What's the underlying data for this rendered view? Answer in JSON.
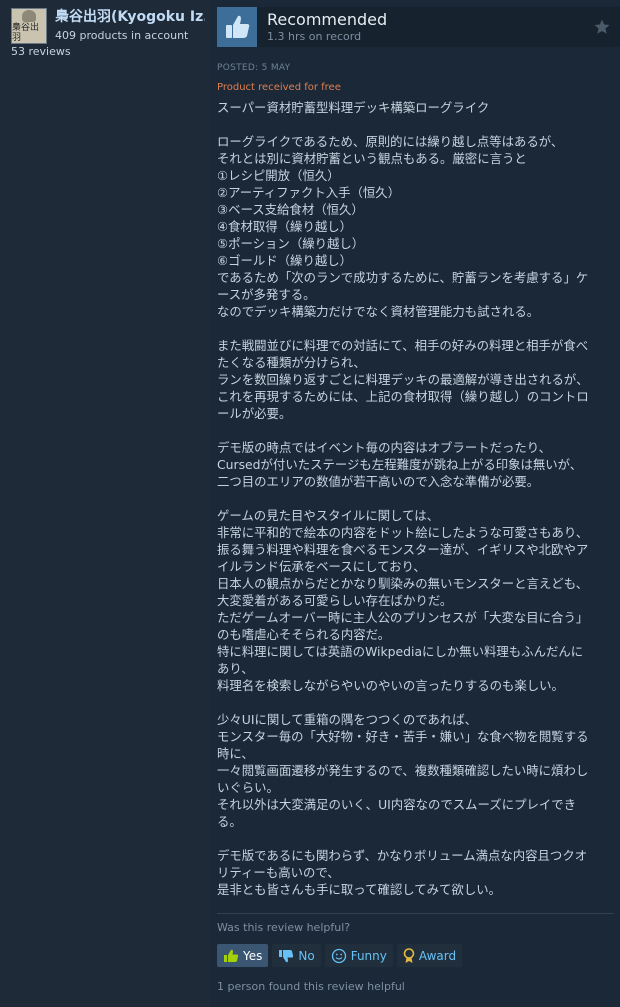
{
  "author": {
    "avatar_text": "梟谷出羽",
    "name": "梟谷出羽(Kyogoku Iz...",
    "products": "409 products in account",
    "reviews": "53 reviews"
  },
  "review": {
    "verdict": "Recommended",
    "hours": "1.3 hrs on record",
    "posted": "POSTED: 5 MAY",
    "received_free": "Product received for free",
    "lines": [
      "スーパー資材貯蓄型料理デッキ構築ローグライク",
      "",
      "ローグライクであるため、原則的には繰り越し点等はあるが、",
      "それとは別に資材貯蓄という観点もある。厳密に言うと",
      "①レシピ開放（恒久）",
      "②アーティファクト入手（恒久）",
      "③ベース支給食材（恒久）",
      "④食材取得（繰り越し）",
      "⑤ポーション（繰り越し）",
      "⑥ゴールド（繰り越し）",
      "であるため「次のランで成功するために、貯蓄ランを考慮する」ケ",
      "ースが多発する。",
      "なのでデッキ構築力だけでなく資材管理能力も試される。",
      "",
      "また戦闘並びに料理での対話にて、相手の好みの料理と相手が食べ",
      "たくなる種類が分けられ、",
      "ランを数回繰り返すごとに料理デッキの最適解が導き出されるが、",
      "これを再現するためには、上記の食材取得（繰り越し）のコントロ",
      "ールが必要。",
      "",
      "デモ版の時点ではイベント毎の内容はオブラートだったり、",
      "Cursedが付いたステージも左程難度が跳ね上がる印象は無いが、",
      "二つ目のエリアの数値が若干高いので入念な準備が必要。",
      "",
      "ゲームの見た目やスタイルに関しては、",
      "非常に平和的で絵本の内容をドット絵にしたような可愛さもあり、",
      "振る舞う料理や料理を食べるモンスター達が、イギリスや北欧やア",
      "イルランド伝承をベースにしており、",
      "日本人の観点からだとかなり馴染みの無いモンスターと言えども、",
      "大変愛着がある可愛らしい存在ばかりだ。",
      "ただゲームオーバー時に主人公のプリンセスが「大変な目に合う」",
      "のも嗜虐心そそられる内容だ。",
      "特に料理に関しては英語のWikpediaにしか無い料理もふんだんに",
      "あり、",
      "料理名を検索しながらやいのやいの言ったりするのも楽しい。",
      "",
      "少々UIに関して重箱の隅をつつくのであれば、",
      "モンスター毎の「大好物・好き・苦手・嫌い」な食べ物を閲覧する",
      "時に、",
      "一々閲覧画面遷移が発生するので、複数種類確認したい時に煩わし",
      "いぐらい。",
      "それ以外は大変満足のいく、UI内容なのでスムーズにプレイでき",
      "る。",
      "",
      "デモ版であるにも関わらず、かなりボリューム満点な内容且つクオ",
      "リティーも高いので、",
      "是非とも皆さんも手に取って確認してみて欲しい。"
    ],
    "helpful_question": "Was this review helpful?",
    "buttons": {
      "yes": "Yes",
      "no": "No",
      "funny": "Funny",
      "award": "Award"
    },
    "found_helpful": "1 person found this review helpful"
  },
  "colors": {
    "background": "#1b2838",
    "accent_link": "#67c1f5",
    "free_label": "#e07f4f",
    "thumb_bg": "#3c6e99"
  },
  "icons": [
    "thumbs-up-icon",
    "star-icon",
    "thumbs-down-icon",
    "smiley-icon",
    "award-icon"
  ]
}
